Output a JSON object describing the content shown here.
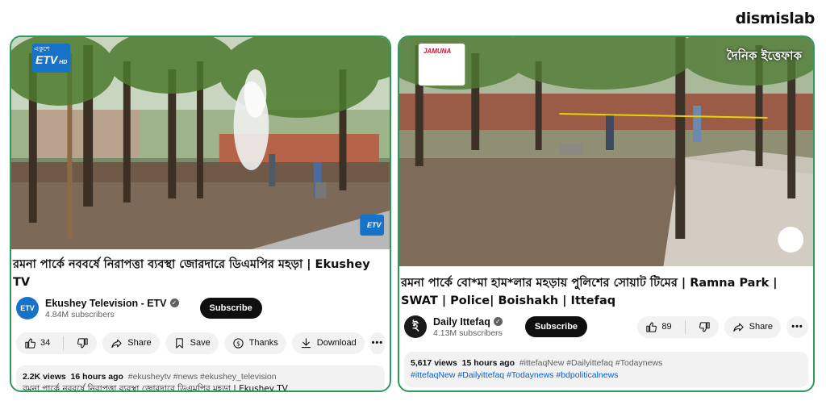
{
  "brand": "dismislab",
  "left": {
    "overlay": {
      "logo_top": "একুশে",
      "logo_main": "ETV",
      "logo_hd": "HD",
      "corner_logo": "ETV"
    },
    "title": "রমনা পার্কে নববর্ষে নিরাপত্তা ব্যবস্থা জোরদারে ডিএমপির মহড়া | Ekushey TV",
    "channel": {
      "name": "Ekushey Television - ETV",
      "subscribers": "4.84M subscribers",
      "avatar": "ETV"
    },
    "subscribe": "Subscribe",
    "likes": "34",
    "share": "Share",
    "save": "Save",
    "thanks": "Thanks",
    "download": "Download",
    "more": "•••",
    "desc": {
      "views": "2.2K views",
      "age": "16 hours ago",
      "tags": "#ekusheytv #news #ekushey_television",
      "line2": "রমনা পার্কে নববর্ষে নিরাপত্তা ব্যবস্থা জোরদারে ডিএমপির মহড়া | Ekushey TV"
    }
  },
  "right": {
    "overlay": {
      "sponsor": "JAMUNA",
      "channel_logo": "দৈনিক ইত্তেফাক"
    },
    "title": "রমনা পার্কে বো*মা হাম*লার মহড়ায় পুলিশের সোয়াট টিমের | Ramna Park | SWAT | Police| Boishakh | Ittefaq",
    "channel": {
      "name": "Daily Ittefaq",
      "subscribers": "4.13M subscribers",
      "avatar": "ই"
    },
    "subscribe": "Subscribe",
    "likes": "89",
    "share": "Share",
    "more": "•••",
    "desc": {
      "views": "5,617 views",
      "age": "15 hours ago",
      "tags": "#ittefaqNew #Dailyittefaq #Todaynews",
      "line2": "#ittefaqNew #Dailyittefaq #Todaynews #bdpoliticalnews"
    }
  },
  "colors": {
    "card_border": "#2e9a5a",
    "pill_bg": "#f2f2f2",
    "subscribe_bg": "#0f0f0f",
    "link_blue": "#065fd4"
  }
}
